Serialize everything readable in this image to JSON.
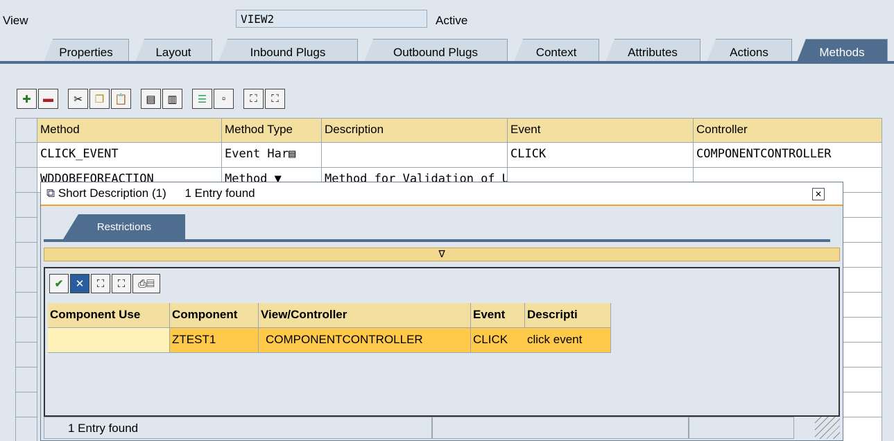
{
  "header": {
    "view_label": "View",
    "view_value": "VIEW2",
    "status": "Active"
  },
  "tabs": [
    {
      "label": "Properties",
      "active": false
    },
    {
      "label": "Layout",
      "active": false
    },
    {
      "label": "Inbound Plugs",
      "active": false
    },
    {
      "label": "Outbound Plugs",
      "active": false
    },
    {
      "label": "Context",
      "active": false
    },
    {
      "label": "Attributes",
      "active": false
    },
    {
      "label": "Actions",
      "active": false
    },
    {
      "label": "Methods",
      "active": true
    }
  ],
  "toolbar_icons": [
    "insert-row-icon",
    "delete-row-icon",
    "cut-icon",
    "copy-icon",
    "paste-icon",
    "append-row-icon",
    "copy-row-icon",
    "details-icon",
    "select-icon",
    "find-icon",
    "find-next-icon"
  ],
  "methods_table": {
    "columns": [
      "Method",
      "Method Type",
      "Description",
      "Event",
      "Controller"
    ],
    "rows": [
      {
        "method": "CLICK_EVENT",
        "type": "Event Har",
        "description": "",
        "event": "CLICK",
        "controller": "COMPONENTCONTROLLER"
      },
      {
        "method": "WDDOBEFOREACTION",
        "type": "Method",
        "description": "Method for Validation of Us",
        "event": "",
        "controller": ""
      }
    ]
  },
  "popup": {
    "title": "Short Description (1)",
    "found": "1 Entry found",
    "restrictions_tab": "Restrictions",
    "toggle_glyph": "∇",
    "inner_toolbar": [
      "ok-check-icon",
      "cancel-icon",
      "find-icon",
      "find-next-icon",
      "print-icon"
    ],
    "columns": [
      "Component Use",
      "Component",
      "View/Controller",
      "Event",
      "Descripti"
    ],
    "rows": [
      {
        "component_use": "",
        "component": "ZTEST1",
        "view_controller": "COMPONENTCONTROLLER",
        "event": "CLICK",
        "description": "click event"
      }
    ],
    "status_text": "1 Entry found"
  },
  "colors": {
    "tab_active": "#4f6e8f",
    "header_cell": "#f3dfa0",
    "selected_row": "#ffc94a",
    "title_underline": "#f0a02a"
  }
}
